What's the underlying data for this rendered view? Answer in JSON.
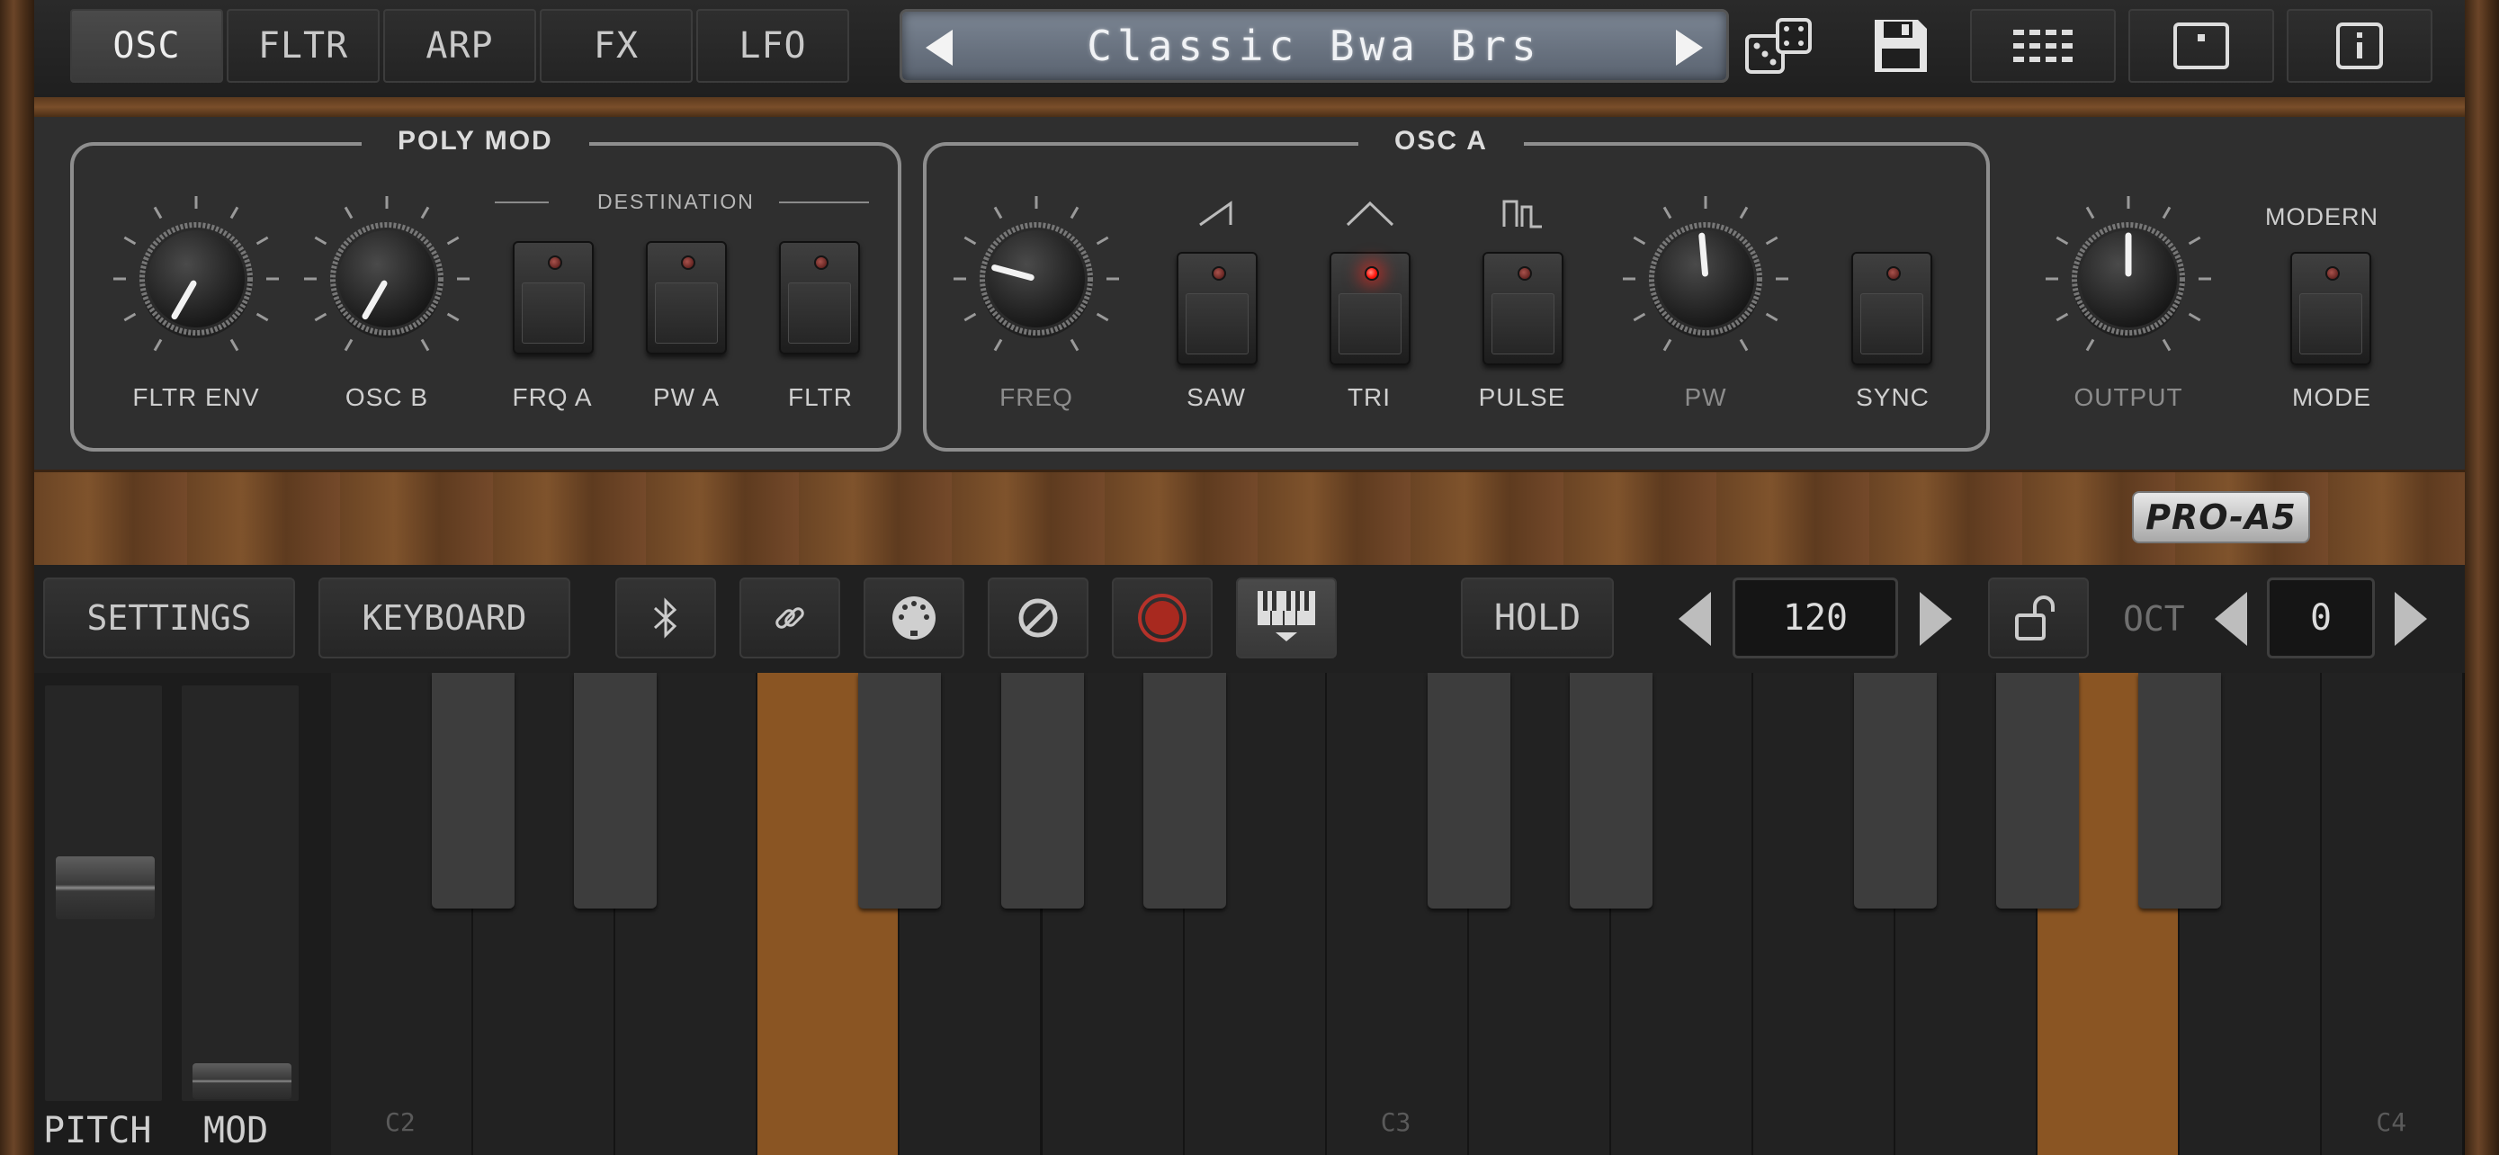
{
  "nav": {
    "tabs": [
      {
        "label": "OSC",
        "active": true
      },
      {
        "label": "FLTR",
        "active": false
      },
      {
        "label": "ARP",
        "active": false
      },
      {
        "label": "FX",
        "active": false
      },
      {
        "label": "LFO",
        "active": false
      }
    ],
    "preset_name": "Classic Bwa Brs",
    "right_icons": [
      "grid-icon",
      "window-icon",
      "info-icon"
    ]
  },
  "poly_mod": {
    "title": "POLY MOD",
    "destination_label": "DESTINATION",
    "knobs": [
      {
        "label": "FLTR ENV"
      },
      {
        "label": "OSC B"
      }
    ],
    "buttons": [
      {
        "label": "FRQ A",
        "on": false
      },
      {
        "label": "PW A",
        "on": false
      },
      {
        "label": "FLTR",
        "on": false
      }
    ]
  },
  "osc_a": {
    "title": "OSC A",
    "freq_label": "FREQ",
    "waves": [
      {
        "label": "SAW",
        "icon": "saw-wave-icon",
        "on": false
      },
      {
        "label": "TRI",
        "icon": "triangle-wave-icon",
        "on": true
      },
      {
        "label": "PULSE",
        "icon": "pulse-wave-icon",
        "on": false
      }
    ],
    "pw_label": "PW",
    "sync_label": "SYNC"
  },
  "output": {
    "output_label": "OUTPUT",
    "modern_label": "MODERN",
    "mode_label": "MODE"
  },
  "logo": "PRO-A5",
  "controls": {
    "settings": "SETTINGS",
    "keyboard": "KEYBOARD",
    "hold": "HOLD",
    "tempo": "120",
    "oct_label": "OCT",
    "oct_value": "0",
    "icons": [
      "bluetooth-icon",
      "link-icon",
      "midi-icon",
      "block-icon",
      "record-icon",
      "keyboard-icon"
    ]
  },
  "wheels": {
    "pitch": "PITCH",
    "mod": "MOD"
  },
  "keyboard": {
    "labels": [
      "C2",
      "C3",
      "C4"
    ],
    "pressed_keys": [
      "F2",
      "A3"
    ]
  }
}
